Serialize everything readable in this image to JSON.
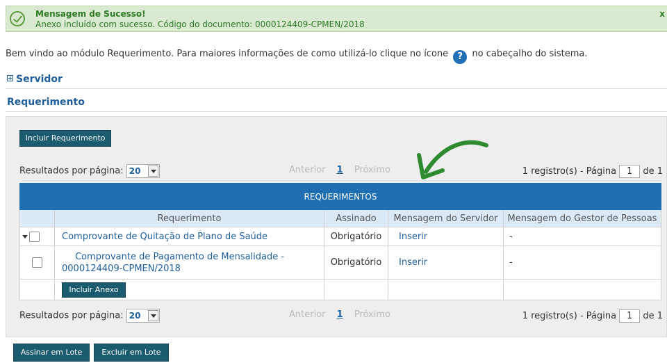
{
  "success": {
    "title": "Mensagem de Sucesso!",
    "message": "Anexo incluído com sucesso. Código do documento: 0000124409-CPMEN/2018",
    "close": "x"
  },
  "welcome": {
    "before": "Bem vindo ao módulo Requerimento. Para maiores informações de como utilizá-lo clique no ícone",
    "icon": "?",
    "after": "no cabeçalho do sistema."
  },
  "sections": {
    "servidor": "Servidor",
    "requerimento": "Requerimento"
  },
  "buttons": {
    "incluir_requerimento": "Incluir Requerimento",
    "incluir_anexo": "Incluir Anexo",
    "assinar_lote": "Assinar em Lote",
    "excluir_lote": "Excluir em Lote"
  },
  "pagination": {
    "results_label": "Resultados por página:",
    "per_page": "20",
    "anterior": "Anterior",
    "current": "1",
    "proximo": "Próximo",
    "registros_label": "1 registro(s) - Página",
    "page_value": "1",
    "of_label": "de 1"
  },
  "table": {
    "caption": "REQUERIMENTOS",
    "headers": [
      "Requerimento",
      "Assinado",
      "Mensagem do Servidor",
      "Mensagem do Gestor de Pessoas"
    ],
    "rows": [
      {
        "requerimento": "Comprovante de Quitação de Plano de Saúde",
        "assinado": "Obrigatório",
        "msg_servidor": "Inserir",
        "msg_gestor": "-"
      },
      {
        "requerimento_line1": "Comprovante de Pagamento de Mensalidade -",
        "requerimento_line2": "0000124409-CPMEN/2018",
        "assinado": "Obrigatório",
        "msg_servidor": "Inserir",
        "msg_gestor": "-"
      }
    ]
  },
  "colors": {
    "header_blue": "#1f6fb2",
    "button_teal": "#1a5b6f",
    "success_bg": "#d9ead0",
    "arrow_green": "#2e8a2e"
  }
}
